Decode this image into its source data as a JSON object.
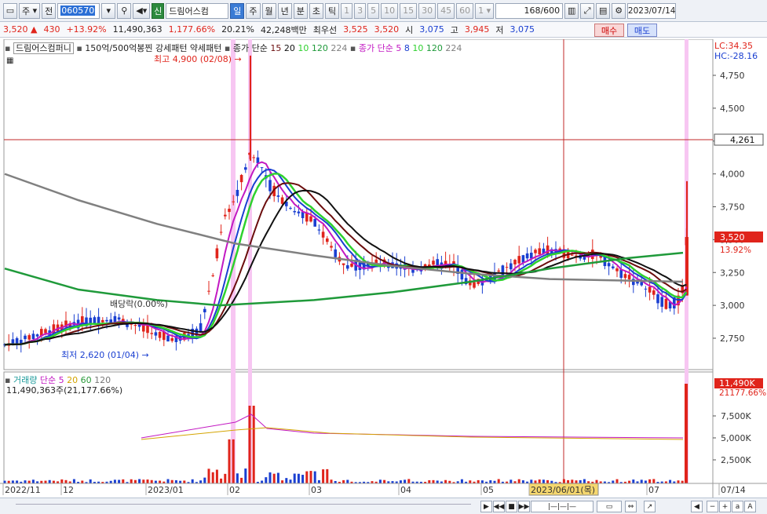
{
  "toolbar": {
    "period_type": "주",
    "previous_label": "전",
    "stock_code": "060570",
    "new_badge": "신",
    "stock_name": "드림어스컴",
    "period_tabs": [
      "일",
      "주",
      "월",
      "년",
      "분",
      "초",
      "틱"
    ],
    "active_tab": "일",
    "interval_buttons": [
      "1",
      "3",
      "5",
      "10",
      "15",
      "30",
      "45",
      "60"
    ],
    "interval_select": "1",
    "count": "168",
    "count_total": "/600",
    "date": "2023/07/14"
  },
  "quote": {
    "price": "3,520",
    "change_arrow": "▲",
    "change": "430",
    "change_pct": "+13.92%",
    "volume": "11,490,363",
    "volume_ratio": "1,177.66%",
    "turnover": "20.21%",
    "amount": "42,248백만",
    "best_ask_label": "최우선",
    "best_ask": "3,525",
    "best_bid": "3,520",
    "open_label": "시",
    "open": "3,075",
    "high_label": "고",
    "high": "3,945",
    "low_label": "저",
    "low": "3,075",
    "buy_label": "매수",
    "sell_label": "매도"
  },
  "legend": {
    "stock_name": "드림어스컴퍼니",
    "pattern_label": "150억/500억봉찐 강세패턴  약세패턴",
    "ma_close_label": "종가 단순",
    "ma_close_periods": [
      "15",
      "20",
      "10",
      "120",
      "224"
    ],
    "ma_close2_label": "종가 단순",
    "ma_close2_periods": [
      "5",
      "8",
      "10",
      "120",
      "224"
    ],
    "lc": "LC:34.35",
    "hc": "HC:-28.16"
  },
  "annotations": {
    "high": "최고 4,900 (02/08)",
    "low": "최저 2,620 (01/04)",
    "dividend": "배당락(0.00%)"
  },
  "price_axis": {
    "ticks": [
      "4,750",
      "4,500",
      "4,250",
      "4,000",
      "3,750",
      "3,500",
      "3,250",
      "3,000",
      "2,750"
    ],
    "crosshair_value": "4,261",
    "current_value": "3,520",
    "current_pct": "13.92%"
  },
  "volume_panel": {
    "label": "거래량",
    "ma_label": "단순",
    "ma_periods": [
      "5",
      "20",
      "60",
      "120"
    ],
    "value_text": "11,490,363주(21,177.66%)",
    "ticks": [
      "7,500K",
      "5,000K",
      "2,500K"
    ],
    "current_value": "11,490K",
    "current_pct": "21177.66%"
  },
  "time_axis": {
    "labels": [
      "2022/11",
      "12",
      "2023/01",
      "02",
      "03",
      "04",
      "05",
      "2023/06/01(목)",
      "07",
      "07/14"
    ]
  },
  "colors": {
    "up": "#e0241b",
    "down": "#1a3fd1",
    "ma5": "#c218c2",
    "ma8": "#1a3fd1",
    "ma10": "#2ed12e",
    "ma120": "#1f9a3a",
    "ma224": "#808080",
    "ma15": "#6b0d0d",
    "ma20": "#111111"
  }
}
